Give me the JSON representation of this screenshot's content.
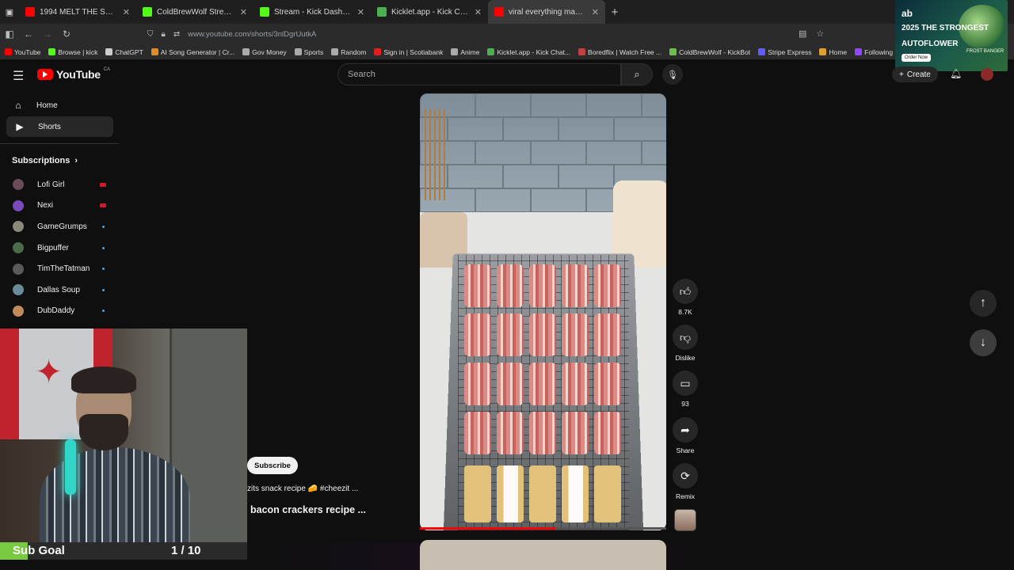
{
  "browser": {
    "tabs": [
      {
        "title": "1994 MELT THE SADNESS // D",
        "favicon_color": "#ff0000",
        "active": false
      },
      {
        "title": "ColdBrewWolf Stream - Watch L",
        "favicon_color": "#53fc18",
        "active": false
      },
      {
        "title": "Stream - Kick Dashboard",
        "favicon_color": "#53fc18",
        "active": false
      },
      {
        "title": "Kicklet.app - Kick Chatbot and",
        "favicon_color": "#4caf50",
        "active": false
      },
      {
        "title": "viral everything maple bac",
        "favicon_color": "#ff0000",
        "active": true
      }
    ],
    "url": "www.youtube.com/shorts/3nlDgrUutkA",
    "bookmarks": [
      {
        "label": "YouTube",
        "color": "#ff0000"
      },
      {
        "label": "Browse | kick",
        "color": "#53fc18"
      },
      {
        "label": "ChatGPT",
        "color": "#cccccc"
      },
      {
        "label": "AI Song Generator | Cr...",
        "color": "#e08a2c"
      },
      {
        "label": "Gov Money",
        "color": "#aaaaaa"
      },
      {
        "label": "Sports",
        "color": "#aaaaaa"
      },
      {
        "label": "Random",
        "color": "#aaaaaa"
      },
      {
        "label": "Sign in | Scotiabank",
        "color": "#e02020"
      },
      {
        "label": "Anime",
        "color": "#aaaaaa"
      },
      {
        "label": "Kicklet.app - Kick Chat...",
        "color": "#4caf50"
      },
      {
        "label": "Boredflix | Watch Free ...",
        "color": "#c04040"
      },
      {
        "label": "ColdBrewWolf - KickBot",
        "color": "#6bc04b"
      },
      {
        "label": "Stripe Express",
        "color": "#635bff"
      },
      {
        "label": "Home",
        "color": "#e0a030"
      },
      {
        "label": "Following - Twitch",
        "color": "#9146ff"
      }
    ]
  },
  "ad": {
    "brand_top": "ab",
    "line1": "2025",
    "line2": "THE STRONGEST",
    "line3": "AUTOFLOWER",
    "button": "Order Now",
    "brand": "FROST BANGER"
  },
  "youtube": {
    "logo_text": "YouTube",
    "country": "CA",
    "search_placeholder": "Search",
    "create_label": "Create"
  },
  "sidebar": {
    "items": [
      {
        "label": "Home",
        "icon": "home-icon",
        "active": false
      },
      {
        "label": "Shorts",
        "icon": "shorts-icon",
        "active": true
      }
    ],
    "subscriptions_label": "Subscriptions",
    "subscriptions": [
      {
        "name": "Lofi Girl",
        "status": "live",
        "avatar_color": "#6b4a5a"
      },
      {
        "name": "Nexi",
        "status": "live",
        "avatar_color": "#7a4ab8"
      },
      {
        "name": "GameGrumps",
        "status": "new",
        "avatar_color": "#8a8a7a"
      },
      {
        "name": "Bigpuffer",
        "status": "new",
        "avatar_color": "#4b6b4b"
      },
      {
        "name": "TimTheTatman",
        "status": "new",
        "avatar_color": "#5a5a5a"
      },
      {
        "name": "Dallas Soup",
        "status": "new",
        "avatar_color": "#6a8a9a"
      },
      {
        "name": "DubDaddy",
        "status": "new",
        "avatar_color": "#c08a5a"
      }
    ]
  },
  "stream_overlay": {
    "sub_goal_label": "Sub Goal",
    "sub_goal_count": "1 / 10",
    "sub_goal_progress": 0.1
  },
  "short": {
    "subscribe_label": "Subscribe",
    "caption": "zits snack recipe 🧀 #cheezit ...",
    "title": "bacon crackers recipe ...",
    "progress": 0.55,
    "actions": [
      {
        "name": "like",
        "icon": "thumbs-up-icon",
        "label": "8.7K"
      },
      {
        "name": "dislike",
        "icon": "thumbs-down-icon",
        "label": "Dislike"
      },
      {
        "name": "comments",
        "icon": "comment-icon",
        "label": "93"
      },
      {
        "name": "share",
        "icon": "share-icon",
        "label": "Share"
      },
      {
        "name": "remix",
        "icon": "remix-icon",
        "label": "Remix"
      }
    ]
  }
}
